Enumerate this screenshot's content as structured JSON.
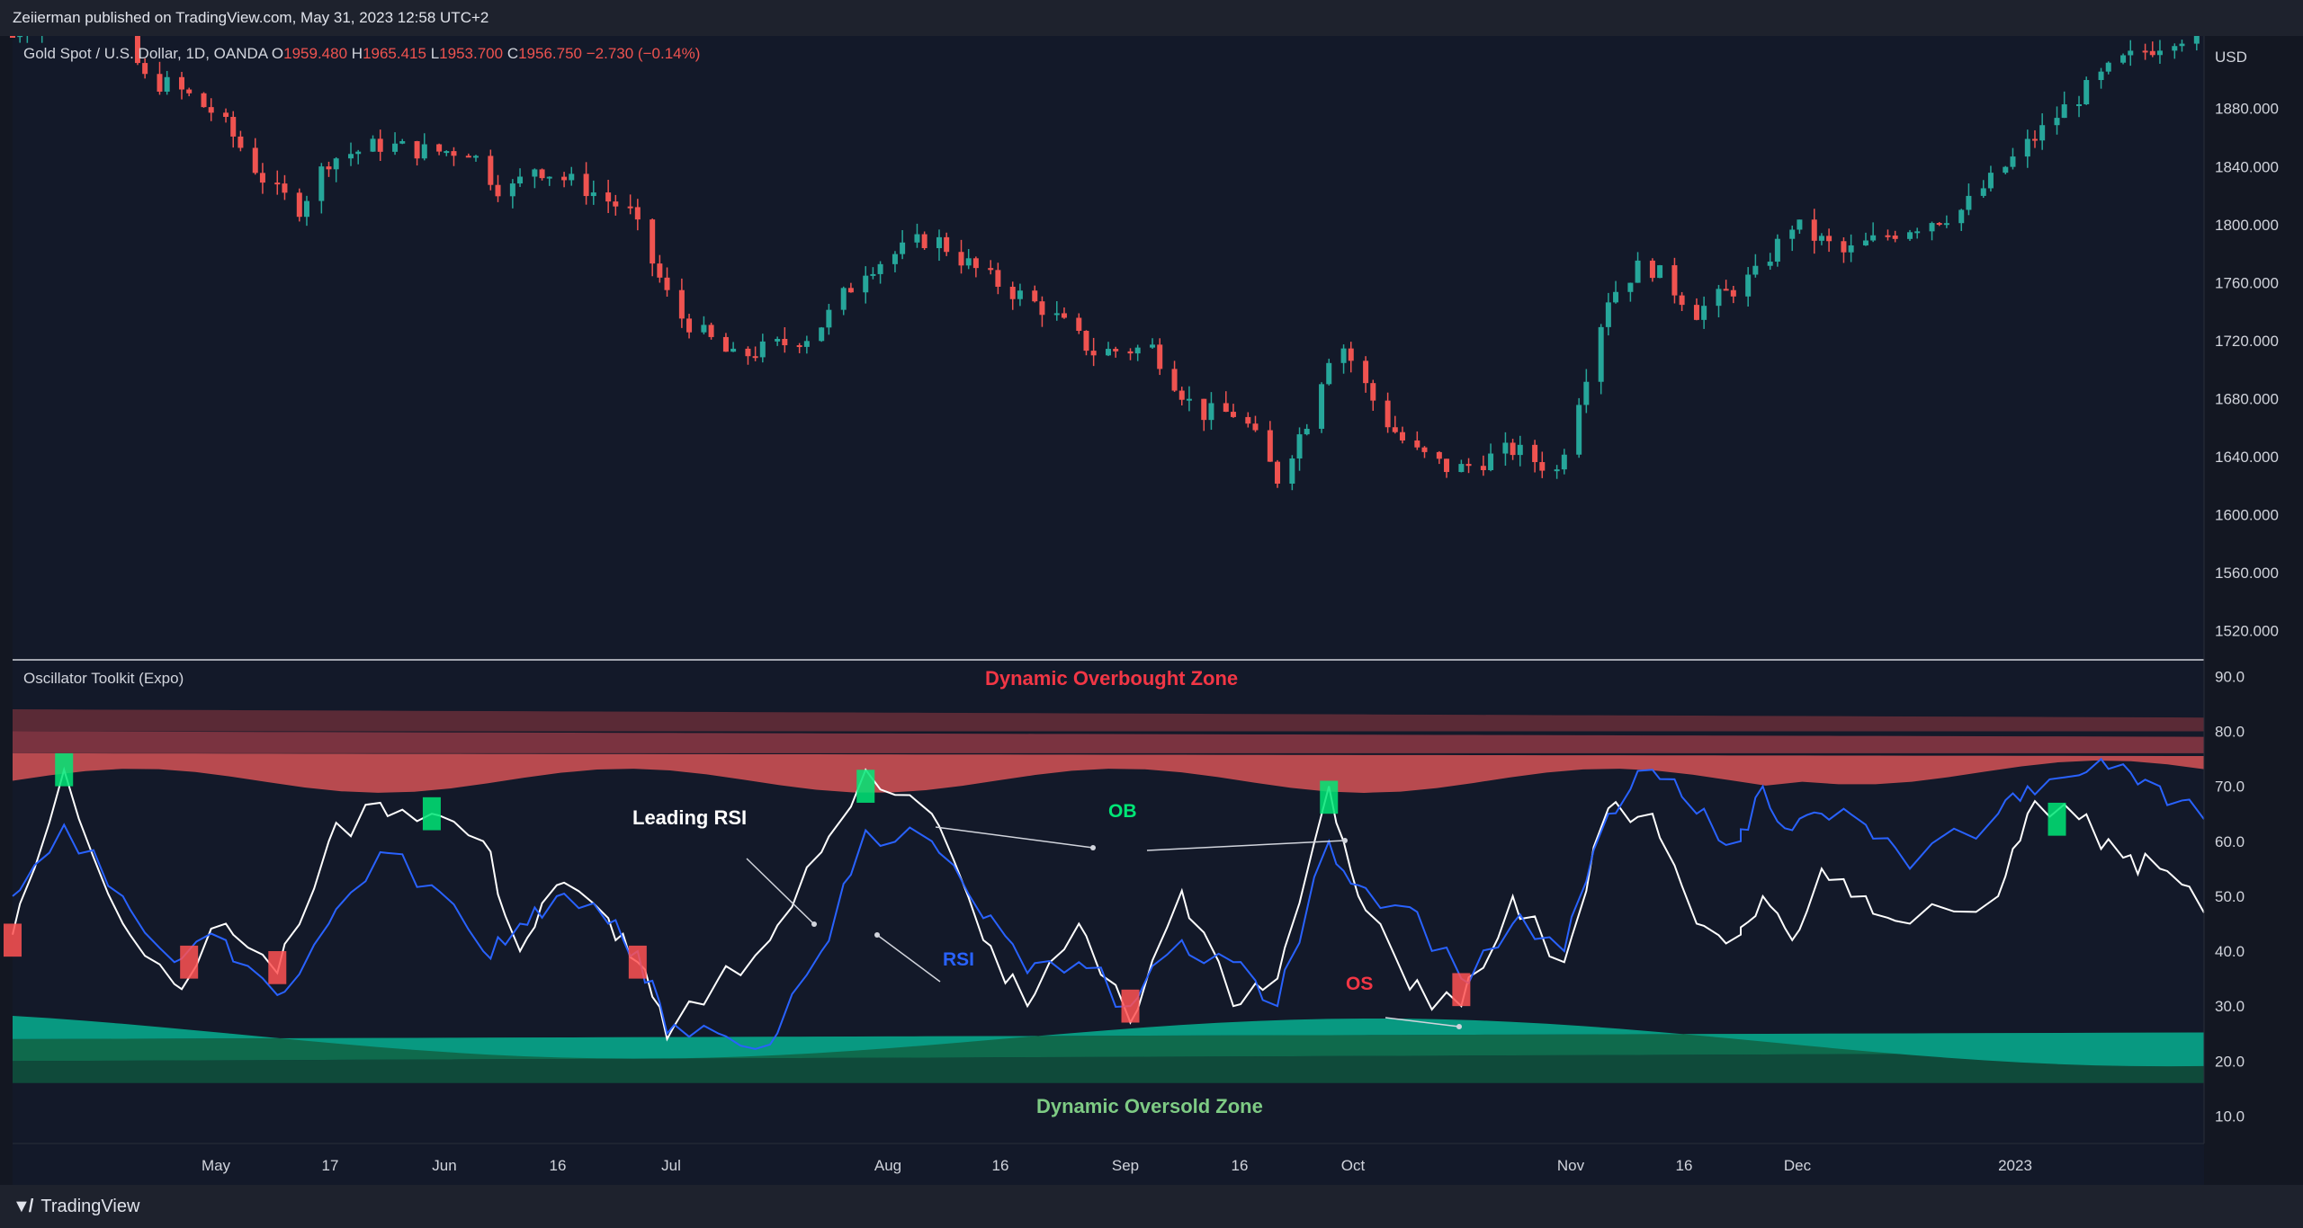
{
  "header": {
    "text": "Zeiierman published on TradingView.com, May 31, 2023 12:58 UTC+2"
  },
  "legend": {
    "symbol": "Gold Spot / U.S. Dollar, 1D, OANDA",
    "open_label": "O",
    "open": "1959.480",
    "high_label": "H",
    "high": "1965.415",
    "low_label": "L",
    "low": "1953.700",
    "close_label": "C",
    "close": "1956.750",
    "change": "−2.730 (−0.14%)"
  },
  "oscillator": {
    "title": "Oscillator Toolkit (Expo)"
  },
  "annotations": {
    "overbought_zone": "Dynamic Overbought Zone",
    "oversold_zone": "Dynamic Oversold Zone",
    "leading_rsi": "Leading RSI",
    "rsi": "RSI",
    "ob": "OB",
    "os": "OS"
  },
  "footer": {
    "logo": "TradingView"
  },
  "colors": {
    "background": "#131722",
    "up_candle": "#26a69a",
    "down_candle": "#ef5350",
    "overbought": "#b84a4f",
    "oversold": "#089981",
    "rsi": "#2962ff",
    "leading_rsi": "#ffffff",
    "ob_fill": "#00e676",
    "os_fill": "#ff5252"
  },
  "chart_data": [
    {
      "type": "candlestick",
      "currency": "USD",
      "ylim": [
        1500,
        1930
      ],
      "y_ticks": [
        1880,
        1840,
        1800,
        1760,
        1720,
        1680,
        1640,
        1600,
        1560,
        1520
      ],
      "y_tick_labels": [
        "1880.000",
        "1840.000",
        "1800.000",
        "1760.000",
        "1720.000",
        "1680.000",
        "1640.000",
        "1600.000",
        "1560.000",
        "1520.000"
      ],
      "x_tick_labels": [
        "May",
        "17",
        "Jun",
        "16",
        "Jul",
        "Aug",
        "16",
        "Sep",
        "16",
        "Oct",
        "Nov",
        "16",
        "Dec",
        "2023"
      ],
      "close_path": [
        [
          "2022-04-07",
          1930
        ],
        [
          "2022-04-18",
          1975
        ],
        [
          "2022-04-25",
          1900
        ],
        [
          "2022-04-29",
          1895
        ],
        [
          "2022-05-05",
          1875
        ],
        [
          "2022-05-12",
          1825
        ],
        [
          "2022-05-16",
          1812
        ],
        [
          "2022-05-20",
          1845
        ],
        [
          "2022-05-27",
          1855
        ],
        [
          "2022-06-03",
          1850
        ],
        [
          "2022-06-08",
          1852
        ],
        [
          "2022-06-13",
          1820
        ],
        [
          "2022-06-17",
          1840
        ],
        [
          "2022-06-24",
          1825
        ],
        [
          "2022-06-30",
          1808
        ],
        [
          "2022-07-06",
          1740
        ],
        [
          "2022-07-14",
          1708
        ],
        [
          "2022-07-21",
          1718
        ],
        [
          "2022-07-25",
          1725
        ],
        [
          "2022-08-01",
          1770
        ],
        [
          "2022-08-10",
          1792
        ],
        [
          "2022-08-17",
          1765
        ],
        [
          "2022-08-26",
          1740
        ],
        [
          "2022-09-01",
          1712
        ],
        [
          "2022-09-09",
          1715
        ],
        [
          "2022-09-15",
          1670
        ],
        [
          "2022-09-21",
          1670
        ],
        [
          "2022-09-26",
          1625
        ],
        [
          "2022-09-30",
          1665
        ],
        [
          "2022-10-04",
          1725
        ],
        [
          "2022-10-10",
          1670
        ],
        [
          "2022-10-14",
          1645
        ],
        [
          "2022-10-20",
          1630
        ],
        [
          "2022-10-28",
          1645
        ],
        [
          "2022-11-03",
          1630
        ],
        [
          "2022-11-10",
          1750
        ],
        [
          "2022-11-15",
          1775
        ],
        [
          "2022-11-22",
          1740
        ],
        [
          "2022-11-30",
          1765
        ],
        [
          "2022-12-05",
          1800
        ],
        [
          "2022-12-12",
          1780
        ],
        [
          "2022-12-19",
          1795
        ],
        [
          "2022-12-28",
          1810
        ],
        [
          "2023-01-03",
          1840
        ],
        [
          "2023-01-11",
          1880
        ],
        [
          "2023-01-18",
          1910
        ],
        [
          "2023-01-26",
          1930
        ]
      ]
    },
    {
      "type": "line",
      "title": "Oscillator Toolkit (Expo)",
      "ylim": [
        5,
        93
      ],
      "y_ticks": [
        90,
        80,
        70,
        60,
        50,
        40,
        30,
        20,
        10
      ],
      "y_tick_labels": [
        "90.0",
        "80.0",
        "70.0",
        "60.0",
        "50.0",
        "40.0",
        "30.0",
        "20.0",
        "10.0"
      ],
      "overbought_zone_bands": [
        84,
        80,
        76
      ],
      "oversold_zone_bands": [
        16,
        20,
        24
      ],
      "series": [
        {
          "name": "Leading RSI",
          "points": [
            [
              "2022-04-07",
              43
            ],
            [
              "2022-04-14",
              73
            ],
            [
              "2022-04-22",
              45
            ],
            [
              "2022-04-29",
              34
            ],
            [
              "2022-05-06",
              45
            ],
            [
              "2022-05-13",
              36
            ],
            [
              "2022-05-20",
              60
            ],
            [
              "2022-05-27",
              67
            ],
            [
              "2022-06-03",
              65
            ],
            [
              "2022-06-10",
              60
            ],
            [
              "2022-06-15",
              40
            ],
            [
              "2022-06-20",
              52
            ],
            [
              "2022-06-27",
              46
            ],
            [
              "2022-07-01",
              38
            ],
            [
              "2022-07-05",
              24
            ],
            [
              "2022-07-12",
              35
            ],
            [
              "2022-07-19",
              42
            ],
            [
              "2022-07-26",
              58
            ],
            [
              "2022-08-01",
              73
            ],
            [
              "2022-08-10",
              65
            ],
            [
              "2022-08-17",
              42
            ],
            [
              "2022-08-23",
              30
            ],
            [
              "2022-08-30",
              45
            ],
            [
              "2022-09-06",
              27
            ],
            [
              "2022-09-13",
              51
            ],
            [
              "2022-09-20",
              30
            ],
            [
              "2022-09-26",
              35
            ],
            [
              "2022-10-03",
              70
            ],
            [
              "2022-10-07",
              50
            ],
            [
              "2022-10-14",
              33
            ],
            [
              "2022-10-21",
              30
            ],
            [
              "2022-10-28",
              50
            ],
            [
              "2022-11-04",
              38
            ],
            [
              "2022-11-10",
              66
            ],
            [
              "2022-11-16",
              65
            ],
            [
              "2022-11-22",
              45
            ],
            [
              "2022-11-28",
              43
            ],
            [
              "2022-12-01",
              50
            ],
            [
              "2022-12-05",
              42
            ],
            [
              "2022-12-09",
              55
            ],
            [
              "2022-12-15",
              50
            ],
            [
              "2022-12-21",
              45
            ],
            [
              "2023-01-02",
              50
            ],
            [
              "2023-01-06",
              65
            ],
            [
              "2023-01-13",
              64
            ],
            [
              "2023-01-19",
              57
            ],
            [
              "2023-01-24",
              55
            ],
            [
              "2023-01-30",
              47
            ]
          ]
        },
        {
          "name": "RSI",
          "points": [
            [
              "2022-04-07",
              50
            ],
            [
              "2022-04-14",
              63
            ],
            [
              "2022-04-22",
              50
            ],
            [
              "2022-04-29",
              38
            ],
            [
              "2022-05-06",
              42
            ],
            [
              "2022-05-13",
              32
            ],
            [
              "2022-05-20",
              45
            ],
            [
              "2022-05-27",
              58
            ],
            [
              "2022-06-03",
              52
            ],
            [
              "2022-06-10",
              40
            ],
            [
              "2022-06-15",
              45
            ],
            [
              "2022-06-20",
              50
            ],
            [
              "2022-06-27",
              45
            ],
            [
              "2022-07-01",
              40
            ],
            [
              "2022-07-05",
              25
            ],
            [
              "2022-07-12",
              25
            ],
            [
              "2022-07-19",
              23
            ],
            [
              "2022-07-26",
              40
            ],
            [
              "2022-08-01",
              62
            ],
            [
              "2022-08-10",
              60
            ],
            [
              "2022-08-17",
              46
            ],
            [
              "2022-08-23",
              36
            ],
            [
              "2022-08-30",
              38
            ],
            [
              "2022-09-06",
              30
            ],
            [
              "2022-09-13",
              42
            ],
            [
              "2022-09-20",
              38
            ],
            [
              "2022-09-26",
              30
            ],
            [
              "2022-10-03",
              60
            ],
            [
              "2022-10-07",
              52
            ],
            [
              "2022-10-14",
              48
            ],
            [
              "2022-10-21",
              35
            ],
            [
              "2022-10-28",
              45
            ],
            [
              "2022-11-04",
              40
            ],
            [
              "2022-11-10",
              65
            ],
            [
              "2022-11-16",
              73
            ],
            [
              "2022-11-22",
              65
            ],
            [
              "2022-11-28",
              60
            ],
            [
              "2022-12-01",
              70
            ],
            [
              "2022-12-05",
              62
            ],
            [
              "2022-12-09",
              65
            ],
            [
              "2022-12-15",
              63
            ],
            [
              "2022-12-21",
              55
            ],
            [
              "2023-01-02",
              65
            ],
            [
              "2023-01-06",
              70
            ],
            [
              "2023-01-13",
              72
            ],
            [
              "2023-01-19",
              74
            ],
            [
              "2023-01-24",
              70
            ],
            [
              "2023-01-30",
              64
            ]
          ]
        }
      ]
    }
  ]
}
